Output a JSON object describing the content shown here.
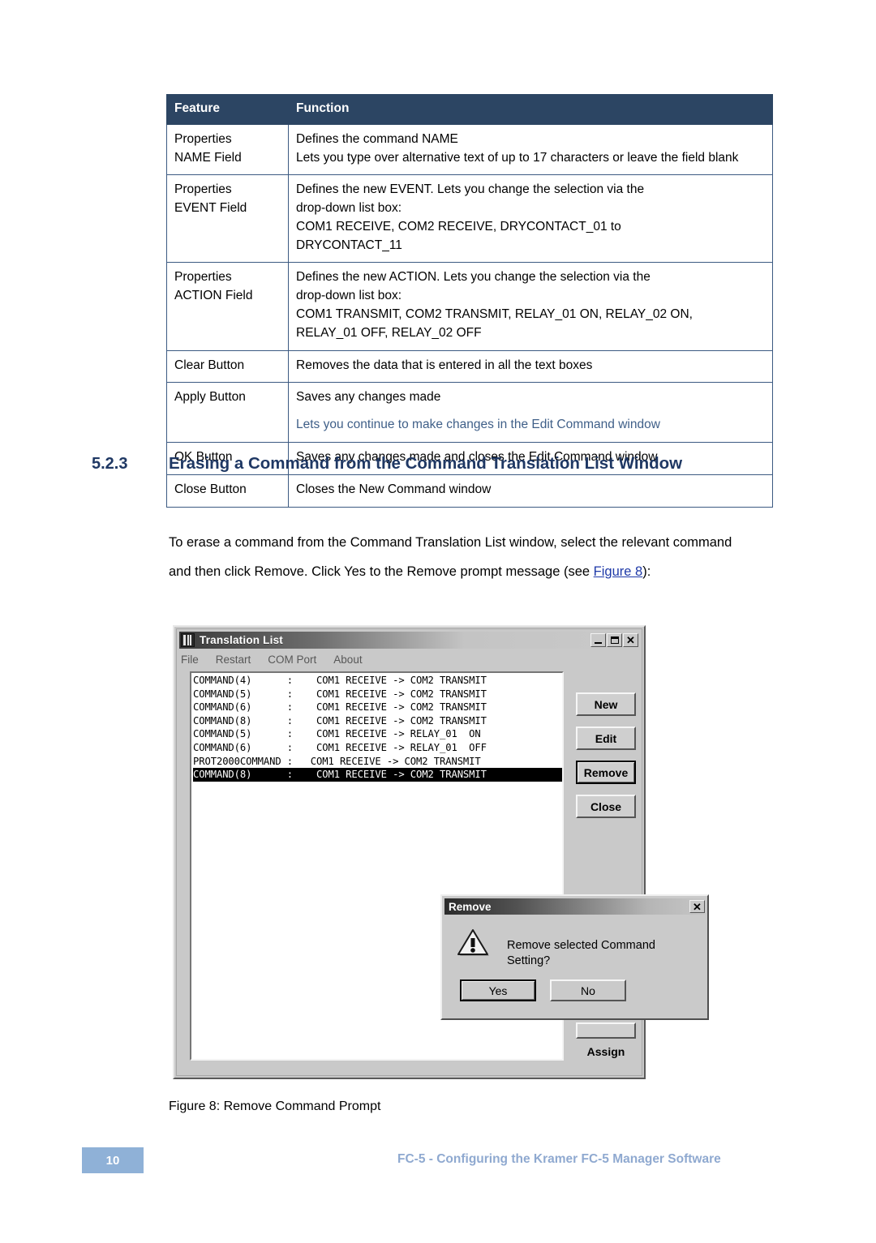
{
  "table": {
    "headers": [
      "Feature",
      "Function"
    ],
    "rows": [
      {
        "feature": [
          "Properties",
          "NAME Field"
        ],
        "function": [
          "Defines the command NAME",
          "Lets you type over alternative text of up to 17 characters or leave the field blank"
        ]
      },
      {
        "feature": [
          "Properties",
          "EVENT Field"
        ],
        "function": [
          "Defines the new EVENT. Lets you change the selection via the",
          "drop-down list box:",
          "COM1 RECEIVE, COM2 RECEIVE, DRYCONTACT_01 to",
          "DRYCONTACT_11"
        ]
      },
      {
        "feature": [
          "Properties",
          "ACTION Field"
        ],
        "function": [
          "Defines the new ACTION. Lets you change the selection via the",
          "drop-down list box:",
          "COM1 TRANSMIT, COM2 TRANSMIT, RELAY_01 ON, RELAY_02 ON,",
          "RELAY_01 OFF, RELAY_02 OFF"
        ]
      },
      {
        "feature": [
          "Clear Button"
        ],
        "function": [
          "Removes the data that is entered in all the text boxes"
        ]
      },
      {
        "feature": [
          "Apply Button"
        ],
        "function": [
          "Saves any changes made"
        ],
        "note": "Lets you continue to make changes in the Edit Command window"
      },
      {
        "feature": [
          "OK Button"
        ],
        "function": [
          "Saves any changes made and closes the Edit Command window"
        ]
      },
      {
        "feature": [
          "Close Button"
        ],
        "function": [
          "Closes the New Command window"
        ]
      }
    ]
  },
  "section": {
    "number": "5.2.3",
    "title": "Erasing a Command from the Command Translation List Window"
  },
  "paragraph": {
    "part1": "To erase a command from the Command Translation List window, select the relevant command and then click Remove. Click Yes to the Remove prompt message (see ",
    "link": "Figure 8",
    "part2": "):"
  },
  "window": {
    "title": "Translation List",
    "menu": [
      "File",
      "Restart",
      "COM Port",
      "About"
    ],
    "list_items": [
      "COMMAND(4)      :    COM1 RECEIVE -> COM2 TRANSMIT",
      "COMMAND(5)      :    COM1 RECEIVE -> COM2 TRANSMIT",
      "COMMAND(6)      :    COM1 RECEIVE -> COM2 TRANSMIT",
      "COMMAND(8)      :    COM1 RECEIVE -> COM2 TRANSMIT",
      "COMMAND(5)      :    COM1 RECEIVE -> RELAY_01  ON",
      "COMMAND(6)      :    COM1 RECEIVE -> RELAY_01  OFF",
      "PROT2000COMMAND :   COM1 RECEIVE -> COM2 TRANSMIT",
      "COMMAND(8)      :    COM1 RECEIVE -> COM2 TRANSMIT"
    ],
    "selected_index": 7,
    "buttons": [
      "New",
      "Edit",
      "Remove",
      "Close"
    ],
    "focused_button": "Remove",
    "assign_label": "Assign"
  },
  "modal": {
    "title": "Remove",
    "message": "Remove selected Command Setting?",
    "yes_label": "Yes",
    "no_label": "No",
    "focused_button": "Yes"
  },
  "caption": "Figure 8: Remove Command Prompt",
  "footer": {
    "page_number": "10",
    "text": "FC-5 - Configuring the Kramer FC-5 Manager Software"
  }
}
